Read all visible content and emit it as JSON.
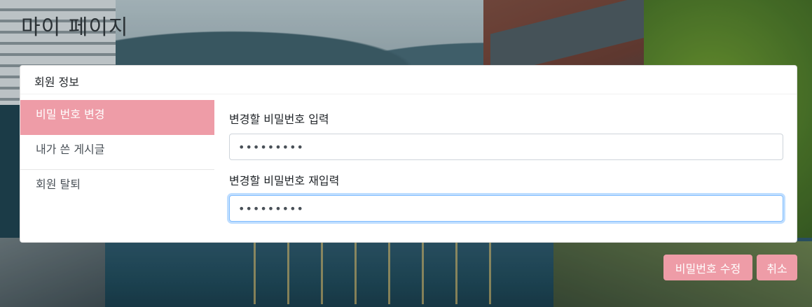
{
  "page": {
    "title": "마이 페이지"
  },
  "card": {
    "header": "회원 정보"
  },
  "menu": {
    "items": [
      {
        "label": "비밀 번호 변경",
        "active": true
      },
      {
        "label": "내가 쓴 게시글",
        "active": false
      },
      {
        "label": "회원 탈퇴",
        "active": false
      }
    ]
  },
  "form": {
    "new_password_label": "변경할 비밀번호 입력",
    "new_password_value": "•••••••••",
    "confirm_password_label": "변경할 비밀번호 재입력",
    "confirm_password_value": "•••••••••"
  },
  "buttons": {
    "change_label": "비밀번호 수정",
    "cancel_label": "취소"
  },
  "colors": {
    "accent": "#ee9ca7",
    "focus": "#80bdff"
  }
}
